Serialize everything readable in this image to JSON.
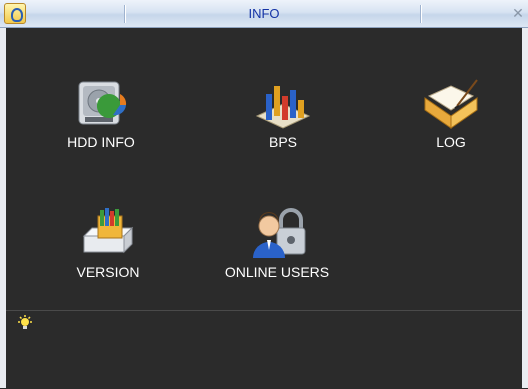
{
  "window": {
    "title": "INFO",
    "close_glyph": "✕"
  },
  "icons": {
    "logo": "app-logo-icon",
    "bulb": "lightbulb-icon"
  },
  "items": [
    {
      "label": "HDD INFO",
      "icon": "hdd-info-icon"
    },
    {
      "label": "BPS",
      "icon": "bps-chart-icon"
    },
    {
      "label": "LOG",
      "icon": "log-book-icon"
    },
    {
      "label": "VERSION",
      "icon": "version-icon"
    },
    {
      "label": "ONLINE USERS",
      "icon": "online-users-icon"
    }
  ],
  "status": {
    "text": ""
  }
}
